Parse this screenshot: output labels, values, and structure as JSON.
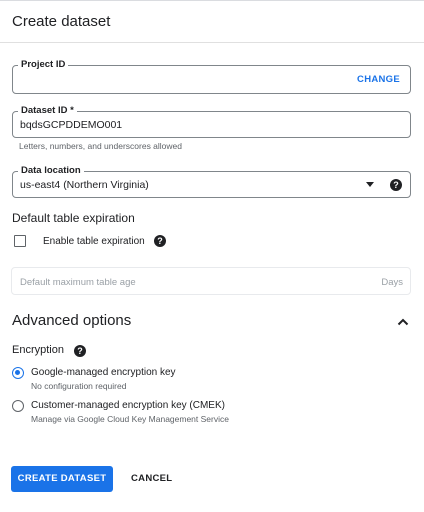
{
  "header": {
    "title": "Create dataset"
  },
  "project_id": {
    "label": "Project ID",
    "value": "",
    "change_label": "CHANGE"
  },
  "dataset_id": {
    "label": "Dataset ID *",
    "value": "bqdsGCPDDEMO001",
    "helper": "Letters, numbers, and underscores allowed"
  },
  "data_location": {
    "label": "Data location",
    "value": "us-east4 (Northern Virginia)",
    "help_glyph": "?"
  },
  "table_expiration": {
    "title": "Default table expiration",
    "checkbox_label": "Enable table expiration",
    "checked": false,
    "help_glyph": "?",
    "max_age_placeholder": "Default maximum table age",
    "max_age_suffix": "Days"
  },
  "advanced": {
    "title": "Advanced options",
    "expanded": true,
    "encryption": {
      "title": "Encryption",
      "help_glyph": "?",
      "options": [
        {
          "label": "Google-managed encryption key",
          "description": "No configuration required",
          "selected": true
        },
        {
          "label": "Customer-managed encryption key (CMEK)",
          "description": "Manage via Google Cloud Key Management Service",
          "selected": false
        }
      ]
    }
  },
  "actions": {
    "create_label": "CREATE DATASET",
    "cancel_label": "CANCEL"
  },
  "colors": {
    "accent": "#1a73e8",
    "text": "#202124",
    "secondary_text": "#5f6368"
  }
}
